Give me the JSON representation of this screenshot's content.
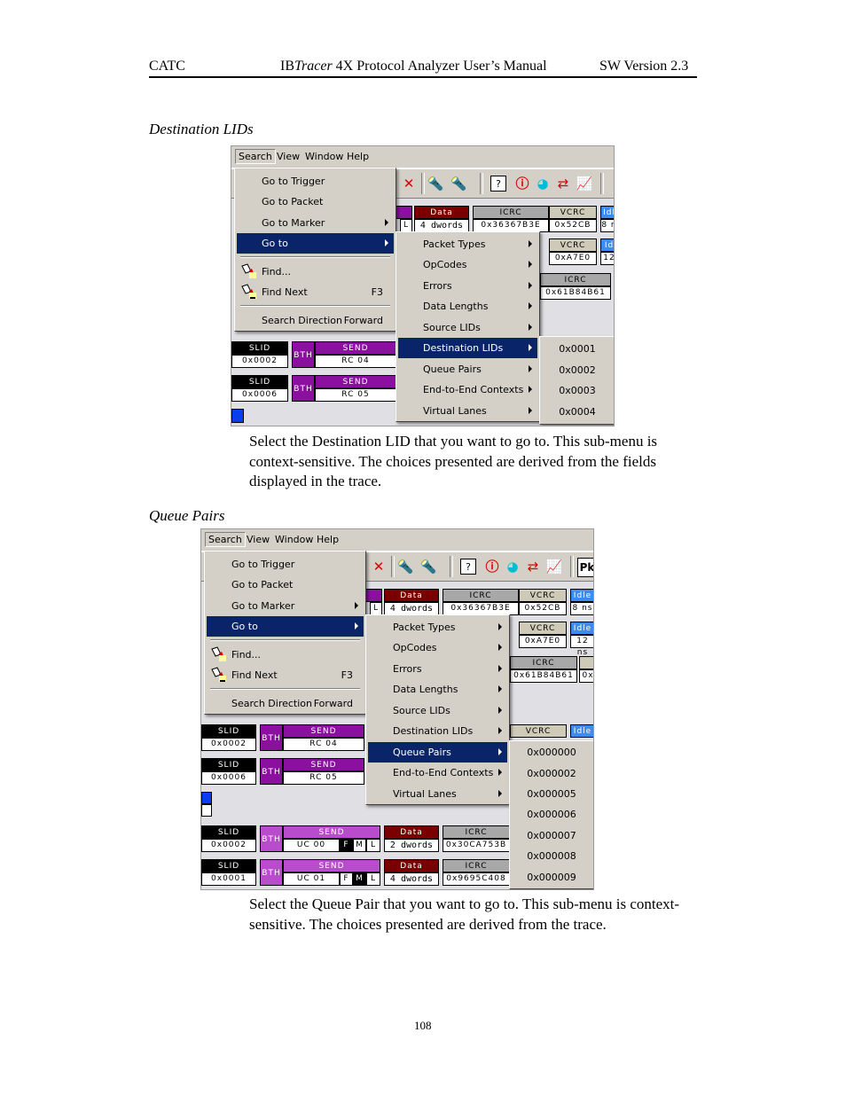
{
  "header": {
    "left": "CATC",
    "center_prefix": "IB",
    "center_italic": "Tracer",
    "center_suffix": " 4X Protocol Analyzer User’s Manual",
    "right": "SW Version 2.3"
  },
  "section1": {
    "caption": "Destination LIDs",
    "menubar": [
      "Search",
      "View",
      "Window",
      "Help"
    ],
    "search_menu": {
      "items": [
        {
          "label": "Go to Trigger"
        },
        {
          "label": "Go to Packet"
        },
        {
          "label": "Go to Marker",
          "submenu": true
        },
        {
          "label": "Go to",
          "submenu": true,
          "highlighted": true
        },
        {
          "label": "Find...",
          "icon": "flashlight-icon"
        },
        {
          "label": "Find Next",
          "shortcut": "F3",
          "icon": "flashlight-next-icon"
        },
        {
          "label": "Search Direction",
          "shortcut": "Forward"
        }
      ]
    },
    "goto_menu": {
      "items": [
        "Packet Types",
        "OpCodes",
        "Errors",
        "Data Lengths",
        "Source LIDs",
        "Destination LIDs",
        "Queue Pairs",
        "End-to-End Contexts",
        "Virtual Lanes"
      ],
      "highlighted": "Destination LIDs"
    },
    "submenu_values": [
      "0x0001",
      "0x0002",
      "0x0003",
      "0x0004"
    ],
    "trace": {
      "data_label": "Data",
      "data_value": "4 dwords",
      "l_flag": "L",
      "icrc_label": "ICRC",
      "icrc_value": "0x36367B3E",
      "vcrc_label": "VCRC",
      "vcrc_value": "0x52CB",
      "idle_label": "Idl",
      "idle_value": "8 n",
      "vcrc2_label": "VCRC",
      "vcrc2_value": "0xA7E0",
      "idle2_label": "Id",
      "idle2_value": "12",
      "icrc3_label": "ICRC",
      "icrc3_value": "0x61B84B61",
      "rows": [
        {
          "slid_label": "SLID",
          "slid_value": "0x0002",
          "bth": "BTH",
          "send_label": "SEND",
          "send_value": "RC 04"
        },
        {
          "slid_label": "SLID",
          "slid_value": "0x0006",
          "bth": "BTH",
          "send_label": "SEND",
          "send_value": "RC 05"
        }
      ]
    },
    "paragraph": "Select the Destination LID that you want to go to.  This sub-menu is context-sensitive.  The choices presented are derived from the fields displayed in the trace."
  },
  "section2": {
    "caption": "Queue Pairs",
    "menubar": [
      "Search",
      "View",
      "Window",
      "Help"
    ],
    "search_menu": {
      "items": [
        {
          "label": "Go to Trigger"
        },
        {
          "label": "Go to Packet"
        },
        {
          "label": "Go to Marker",
          "submenu": true
        },
        {
          "label": "Go to",
          "submenu": true,
          "highlighted": true
        },
        {
          "label": "Find...",
          "icon": "flashlight-icon"
        },
        {
          "label": "Find Next",
          "shortcut": "F3",
          "icon": "flashlight-next-icon"
        },
        {
          "label": "Search Direction",
          "shortcut": "Forward"
        }
      ]
    },
    "goto_menu": {
      "items": [
        "Packet Types",
        "OpCodes",
        "Errors",
        "Data Lengths",
        "Source LIDs",
        "Destination LIDs",
        "Queue Pairs",
        "End-to-End Contexts",
        "Virtual Lanes"
      ],
      "highlighted": "Queue Pairs"
    },
    "submenu_values": [
      "0x000000",
      "0x000002",
      "0x000005",
      "0x000006",
      "0x000007",
      "0x000008",
      "0x000009"
    ],
    "trace": {
      "data_label": "Data",
      "data_value": "4 dwords",
      "l_flag": "L",
      "icrc_label": "ICRC",
      "icrc_value": "0x36367B3E",
      "vcrc_label": "VCRC",
      "vcrc_value": "0x52CB",
      "idle_label": "Idle",
      "idle_value": "8 ns",
      "vcrc2_label": "VCRC",
      "vcrc2_value": "0xA7E0",
      "idle2_label": "Idle",
      "idle2_value": "12 ns",
      "icrc3_label": "ICRC",
      "icrc3_value": "0x61B84B61",
      "icrc3_next": "0x",
      "vcrc4_label": "VCRC",
      "idle4_label": "Idle",
      "pk_label": "Pk",
      "rows": [
        {
          "slid_label": "SLID",
          "slid_value": "0x0002",
          "bth": "BTH",
          "send_label": "SEND",
          "send_value": "RC 04"
        },
        {
          "slid_label": "SLID",
          "slid_value": "0x0006",
          "bth": "BTH",
          "send_label": "SEND",
          "send_value": "RC 05"
        }
      ],
      "uc_rows": [
        {
          "slid_label": "SLID",
          "slid_value": "0x0002",
          "bth": "BTH",
          "send_label": "SEND",
          "send_value": "UC 00",
          "f": "F",
          "m": "M",
          "l": "L",
          "data_label": "Data",
          "data_value": "2 dwords",
          "icrc_label": "ICRC",
          "icrc_value": "0x30CA753B"
        },
        {
          "slid_label": "SLID",
          "slid_value": "0x0001",
          "bth": "BTH",
          "send_label": "SEND",
          "send_value": "UC 01",
          "f": "F",
          "m": "M",
          "l": "L",
          "data_label": "Data",
          "data_value": "4 dwords",
          "icrc_label": "ICRC",
          "icrc_value": "0x9695C408"
        }
      ]
    },
    "paragraph": "Select the Queue Pair that you want to go to. This sub-menu is context-sensitive. The choices presented are derived from the trace."
  },
  "footer": {
    "page_number": "108"
  }
}
